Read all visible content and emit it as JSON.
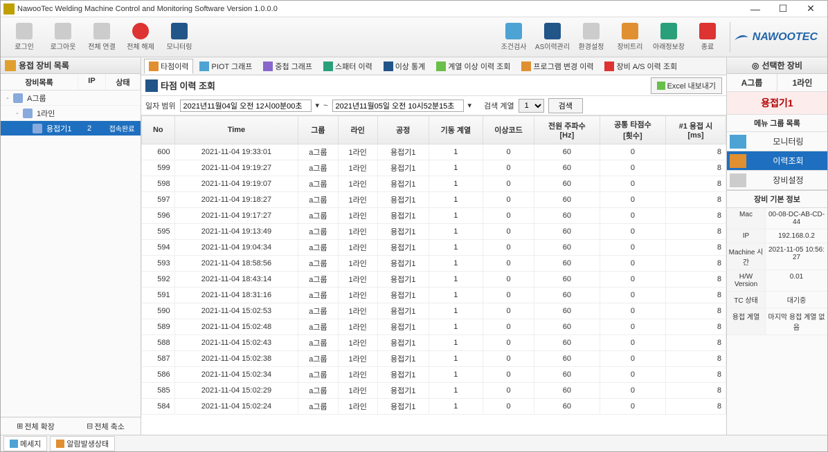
{
  "title": "NawooTec Welding Machine Control and Monitoring Software Version 1.0.0.0",
  "logo": "NAWOOTEC",
  "toolbar": {
    "login": "로그인",
    "logout": "로그아웃",
    "conn_all": "전체 연결",
    "disconn_all": "전체 해제",
    "monitor": "모니터링",
    "cond_check": "조건검사",
    "as_history": "AS이력관리",
    "settings": "환경설정",
    "equip_tree": "장비트리",
    "info_window": "아래정보창",
    "exit": "종료"
  },
  "left": {
    "header": "용접 장비 목록",
    "cols": {
      "name": "장비목록",
      "ip": "IP",
      "status": "상태"
    },
    "rows": [
      {
        "indent": 0,
        "name": "A그룹",
        "ip": "",
        "status": "",
        "expand": "-"
      },
      {
        "indent": 1,
        "name": "1라인",
        "ip": "",
        "status": "",
        "expand": "-"
      },
      {
        "indent": 2,
        "name": "용접기1",
        "ip": "2",
        "status": "접속완료",
        "selected": true
      }
    ],
    "expand_all": "전체 확장",
    "collapse_all": "전체 축소"
  },
  "center": {
    "subtabs": [
      "타점이력",
      "PIOT 그래프",
      "중첩 그래프",
      "스패터 이력",
      "이상 통계",
      "계열 이상 이력 조회",
      "프로그램 변경 이력",
      "장비 A/S 이력 조회"
    ],
    "active_tab": 0,
    "grid_title": "타점 이력 조회",
    "excel_btn": "Excel 내보내기",
    "filter": {
      "date_label": "일자 범위",
      "from": "2021년11월04일 오전 12시00분00초",
      "to": "2021년11월05일 오전 10시52분15초",
      "tilde": "~",
      "search_col_label": "검색 계열",
      "search_col_val": "1",
      "search_btn": "검색"
    },
    "columns": [
      "No",
      "Time",
      "그룹",
      "라인",
      "공정",
      "기동 계열",
      "이상코드",
      "전원 주파수\n[Hz]",
      "공통 타점수\n[횟수]",
      "#1 용접 시\n[ms]"
    ],
    "rows": [
      {
        "no": 600,
        "time": "2021-11-04 19:33:01",
        "g": "a그룹",
        "l": "1라인",
        "p": "용접기1",
        "s": 1,
        "e": 0,
        "hz": 60,
        "cnt": 0,
        "ms": "8"
      },
      {
        "no": 599,
        "time": "2021-11-04 19:19:27",
        "g": "a그룹",
        "l": "1라인",
        "p": "용접기1",
        "s": 1,
        "e": 0,
        "hz": 60,
        "cnt": 0,
        "ms": "8"
      },
      {
        "no": 598,
        "time": "2021-11-04 19:19:07",
        "g": "a그룹",
        "l": "1라인",
        "p": "용접기1",
        "s": 1,
        "e": 0,
        "hz": 60,
        "cnt": 0,
        "ms": "8"
      },
      {
        "no": 597,
        "time": "2021-11-04 19:18:27",
        "g": "a그룹",
        "l": "1라인",
        "p": "용접기1",
        "s": 1,
        "e": 0,
        "hz": 60,
        "cnt": 0,
        "ms": "8"
      },
      {
        "no": 596,
        "time": "2021-11-04 19:17:27",
        "g": "a그룹",
        "l": "1라인",
        "p": "용접기1",
        "s": 1,
        "e": 0,
        "hz": 60,
        "cnt": 0,
        "ms": "8"
      },
      {
        "no": 595,
        "time": "2021-11-04 19:13:49",
        "g": "a그룹",
        "l": "1라인",
        "p": "용접기1",
        "s": 1,
        "e": 0,
        "hz": 60,
        "cnt": 0,
        "ms": "8"
      },
      {
        "no": 594,
        "time": "2021-11-04 19:04:34",
        "g": "a그룹",
        "l": "1라인",
        "p": "용접기1",
        "s": 1,
        "e": 0,
        "hz": 60,
        "cnt": 0,
        "ms": "8"
      },
      {
        "no": 593,
        "time": "2021-11-04 18:58:56",
        "g": "a그룹",
        "l": "1라인",
        "p": "용접기1",
        "s": 1,
        "e": 0,
        "hz": 60,
        "cnt": 0,
        "ms": "8"
      },
      {
        "no": 592,
        "time": "2021-11-04 18:43:14",
        "g": "a그룹",
        "l": "1라인",
        "p": "용접기1",
        "s": 1,
        "e": 0,
        "hz": 60,
        "cnt": 0,
        "ms": "8"
      },
      {
        "no": 591,
        "time": "2021-11-04 18:31:16",
        "g": "a그룹",
        "l": "1라인",
        "p": "용접기1",
        "s": 1,
        "e": 0,
        "hz": 60,
        "cnt": 0,
        "ms": "8"
      },
      {
        "no": 590,
        "time": "2021-11-04 15:02:53",
        "g": "a그룹",
        "l": "1라인",
        "p": "용접기1",
        "s": 1,
        "e": 0,
        "hz": 60,
        "cnt": 0,
        "ms": "8"
      },
      {
        "no": 589,
        "time": "2021-11-04 15:02:48",
        "g": "a그룹",
        "l": "1라인",
        "p": "용접기1",
        "s": 1,
        "e": 0,
        "hz": 60,
        "cnt": 0,
        "ms": "8"
      },
      {
        "no": 588,
        "time": "2021-11-04 15:02:43",
        "g": "a그룹",
        "l": "1라인",
        "p": "용접기1",
        "s": 1,
        "e": 0,
        "hz": 60,
        "cnt": 0,
        "ms": "8"
      },
      {
        "no": 587,
        "time": "2021-11-04 15:02:38",
        "g": "a그룹",
        "l": "1라인",
        "p": "용접기1",
        "s": 1,
        "e": 0,
        "hz": 60,
        "cnt": 0,
        "ms": "8"
      },
      {
        "no": 586,
        "time": "2021-11-04 15:02:34",
        "g": "a그룹",
        "l": "1라인",
        "p": "용접기1",
        "s": 1,
        "e": 0,
        "hz": 60,
        "cnt": 0,
        "ms": "8"
      },
      {
        "no": 585,
        "time": "2021-11-04 15:02:29",
        "g": "a그룹",
        "l": "1라인",
        "p": "용접기1",
        "s": 1,
        "e": 0,
        "hz": 60,
        "cnt": 0,
        "ms": "8"
      },
      {
        "no": 584,
        "time": "2021-11-04 15:02:24",
        "g": "a그룹",
        "l": "1라인",
        "p": "용접기1",
        "s": 1,
        "e": 0,
        "hz": 60,
        "cnt": 0,
        "ms": "8"
      }
    ]
  },
  "right": {
    "header": "선택한 장비",
    "bc": {
      "group": "A그룹",
      "line": "1라인"
    },
    "welder": "용접기1",
    "menu_group": "메뉴 그룹 목록",
    "menu": [
      {
        "label": "모니터링",
        "active": false
      },
      {
        "label": "이력조회",
        "active": true
      },
      {
        "label": "장비설정",
        "active": false
      }
    ],
    "info_head": "장비 기본 정보",
    "info": [
      {
        "k": "Mac",
        "v": "00-08-DC-AB-CD-44"
      },
      {
        "k": "IP",
        "v": "192.168.0.2"
      },
      {
        "k": "Machine 시간",
        "v": "2021-11-05 10:56:27"
      },
      {
        "k": "H/W Version",
        "v": "0.01"
      },
      {
        "k": "TC 상태",
        "v": "대기중"
      },
      {
        "k": "용접 계열",
        "v": "마지막 용접 계열 없음"
      }
    ]
  },
  "bottom_tabs": {
    "msg": "메세지",
    "alarm": "알람발생상태"
  }
}
